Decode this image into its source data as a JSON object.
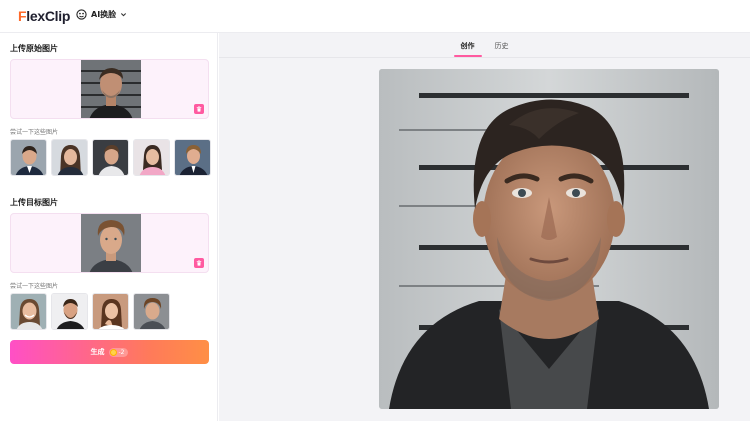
{
  "header": {
    "logo_prefix": "F",
    "logo_rest": "lexClip",
    "tool_label": "AI换脸",
    "icons": [
      "face-swap-icon",
      "chevron-down-icon"
    ]
  },
  "source_section": {
    "title": "上传原始图片",
    "hint": "尝试一下这些图片",
    "thumbnails": [
      "man-in-suit",
      "woman-in-blazer",
      "man-in-shirt",
      "woman-in-pink",
      "boy-in-suit"
    ]
  },
  "target_section": {
    "title": "上传目标图片",
    "hint": "尝试一下这些图片",
    "thumbnails": [
      "smiling-woman",
      "bearded-man",
      "woman-hand-on-face",
      "curly-haired-man"
    ]
  },
  "generate": {
    "label": "生成",
    "cost": "-2"
  },
  "tabs": [
    {
      "label": "创作",
      "active": true
    },
    {
      "label": "历史",
      "active": false
    }
  ],
  "colors": {
    "accent_pink": "#ff5aa0",
    "button_gradient_start": "#ff4fc6",
    "button_gradient_end": "#ff8f45",
    "upload_bg": "#fdf2fb"
  }
}
